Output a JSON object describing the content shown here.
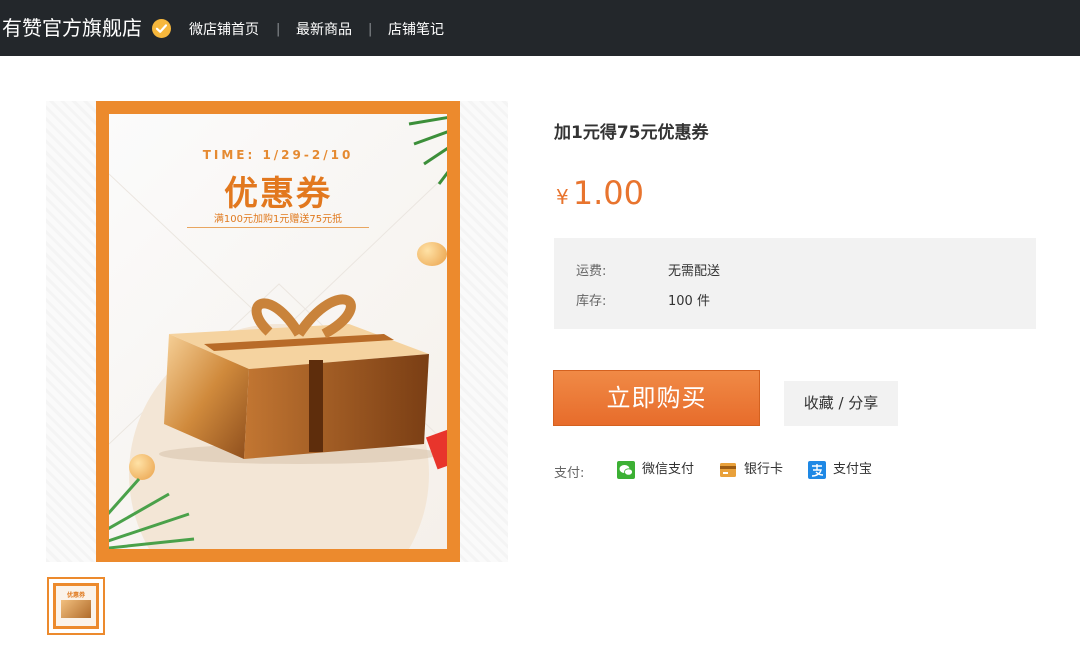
{
  "header": {
    "shop_name": "有赞官方旗舰店",
    "verified_icon": "verified-check-icon",
    "nav": [
      "微店铺首页",
      "最新商品",
      "店铺笔记"
    ],
    "separator": "|"
  },
  "product_image": {
    "time_text": "TIME: 1/29-2/10",
    "title": "优惠券",
    "subtitle": "满100元加购1元赠送75元抵"
  },
  "thumbnail": {
    "title": "优惠券"
  },
  "product": {
    "title": "加1元得75元优惠券",
    "currency": "¥",
    "price": "1.00",
    "shipping_label": "运费:",
    "shipping_value": "无需配送",
    "stock_label": "库存:",
    "stock_value": "100 件"
  },
  "actions": {
    "buy": "立即购买",
    "fav_share": "收藏 / 分享"
  },
  "payment": {
    "label": "支付:",
    "methods": [
      {
        "name": "微信支付",
        "icon": "wechat-pay-icon",
        "color": "#3cb034"
      },
      {
        "name": "银行卡",
        "icon": "bank-card-icon",
        "color": "#e9a13b"
      },
      {
        "name": "支付宝",
        "icon": "alipay-icon",
        "color": "#1e88e5"
      }
    ]
  },
  "colors": {
    "accent": "#e8742e",
    "topbar": "#23272b",
    "poster_border": "#ec8a2d"
  }
}
